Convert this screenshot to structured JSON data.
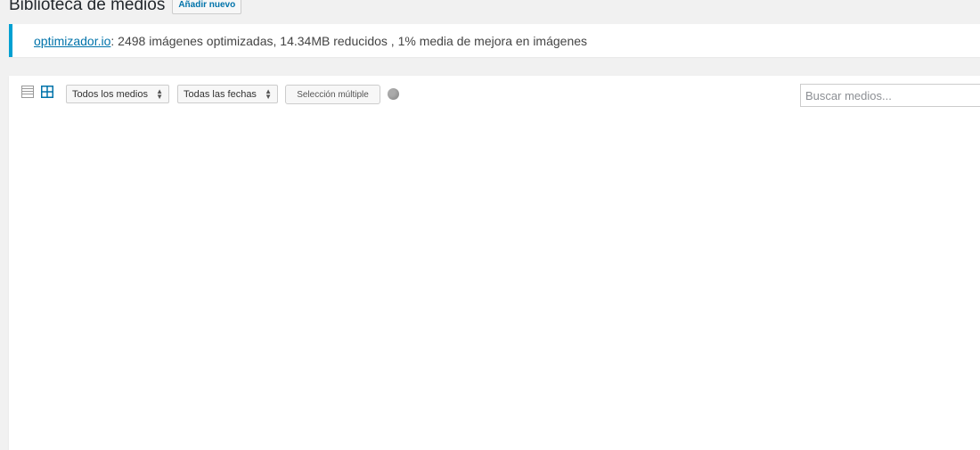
{
  "header": {
    "title": "Biblioteca de medios",
    "add_new_label": "Añadir nuevo"
  },
  "notice": {
    "link_text": "optimizador.io",
    "message": ": 2498 imágenes optimizadas, 14.34MB reducidos , 1% media de mejora en imágenes"
  },
  "toolbar": {
    "view_list_icon": "list-view-icon",
    "view_grid_icon": "grid-view-icon",
    "type_filter": "Todos los medios",
    "date_filter": "Todas las fechas",
    "bulk_select_label": "Selección múltiple",
    "search_placeholder": "Buscar medios..."
  },
  "colors": {
    "accent": "#0073aa",
    "notice_border": "#00a0d2"
  }
}
